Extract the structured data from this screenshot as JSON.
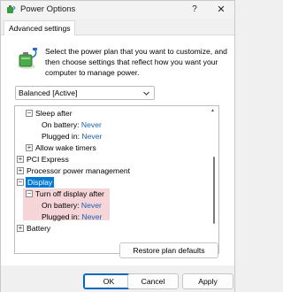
{
  "window": {
    "title": "Power Options",
    "help_glyph": "?",
    "close_glyph": "✕",
    "app_icon": "power-options-icon"
  },
  "tabs": [
    {
      "label": "Advanced settings",
      "selected": true
    }
  ],
  "intro_text": "Select the power plan that you want to customize, and then choose settings that reflect how you want your computer to manage power.",
  "plan_select": {
    "value": "Balanced [Active]"
  },
  "tree": {
    "sleep_after": {
      "label": "Sleep after",
      "expanded": true
    },
    "sleep_on_battery": {
      "label": "On battery:",
      "value": "Never"
    },
    "sleep_plugged_in": {
      "label": "Plugged in:",
      "value": "Never"
    },
    "allow_wake_timers": {
      "label": "Allow wake timers",
      "expanded": false
    },
    "pci_express": {
      "label": "PCI Express",
      "expanded": false
    },
    "processor_power": {
      "label": "Processor power management",
      "expanded": false
    },
    "display": {
      "label": "Display",
      "expanded": true,
      "selected": true
    },
    "turn_off_display": {
      "label": "Turn off display after",
      "expanded": true
    },
    "display_on_battery": {
      "label": "On battery:",
      "value": "Never"
    },
    "display_plugged_in": {
      "label": "Plugged in:",
      "value": "Never"
    },
    "battery": {
      "label": "Battery",
      "expanded": false
    }
  },
  "buttons": {
    "restore": "Restore plan defaults",
    "ok": "OK",
    "cancel": "Cancel",
    "apply": "Apply"
  },
  "colors": {
    "selection": "#0078d7",
    "highlight_pink": "#f6d5d9",
    "link": "#1a5fb4"
  }
}
